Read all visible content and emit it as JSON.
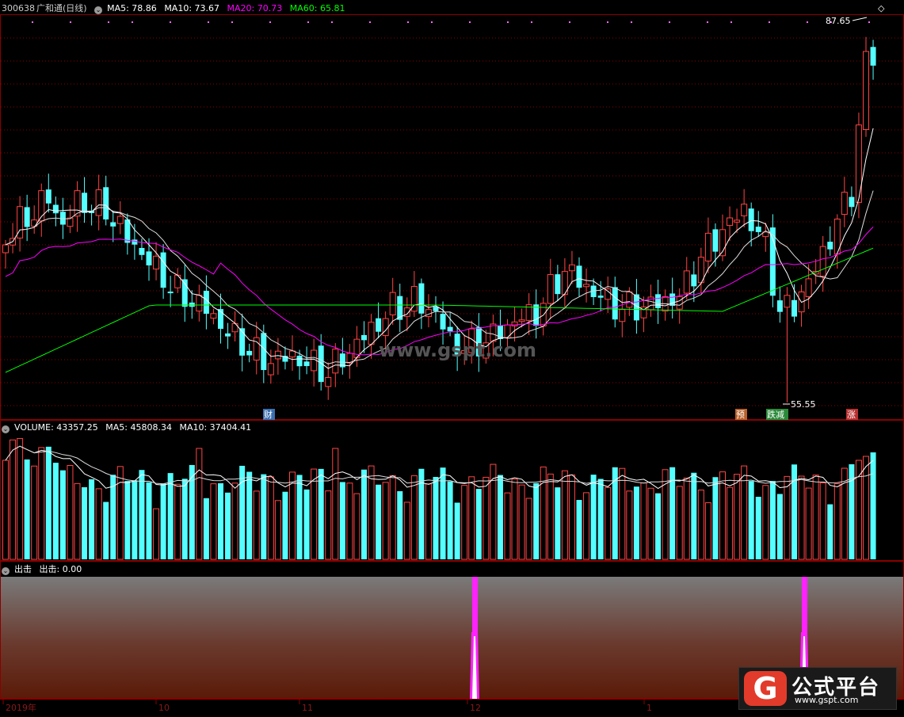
{
  "colors": {
    "up": "#ff4444",
    "down": "#54ffff",
    "ma5": "#ffffff",
    "ma10": "#ffffff",
    "ma20": "#ff00ff",
    "ma60": "#00ff00",
    "grid": "#8b0000",
    "signal": "#ff22ff"
  },
  "main": {
    "code": "300638",
    "name": "广和通",
    "period": "(日线)",
    "ma5": "MA5: 78.86",
    "ma10": "MA10: 73.67",
    "ma20": "MA20: 70.73",
    "ma60": "MA60: 65.81",
    "high_label": "87.65",
    "low_label": "55.55",
    "watermark": "www.gspt.com",
    "markers": [
      "财",
      "预",
      "跌减",
      "涨"
    ]
  },
  "volume": {
    "title": "VOLUME: 43357.25",
    "ma5": "MA5: 45808.34",
    "ma10": "MA10: 37404.41"
  },
  "indicator": {
    "title": "出击",
    "value": "出击: 0.00"
  },
  "time_axis": [
    "2019年",
    "10",
    "11",
    "12",
    "1"
  ],
  "logo": {
    "mark": "G",
    "title": "公式平台",
    "url": "www.gspt.com"
  },
  "chart_data": {
    "type": "candlestick",
    "price_range": [
      55.55,
      87.65
    ],
    "series": [
      {
        "name": "MA5"
      },
      {
        "name": "MA10"
      },
      {
        "name": "MA20"
      },
      {
        "name": "MA60"
      }
    ],
    "signal_days": [
      {
        "month": "12",
        "value": 1
      },
      {
        "month": "1",
        "value": 1
      }
    ]
  }
}
